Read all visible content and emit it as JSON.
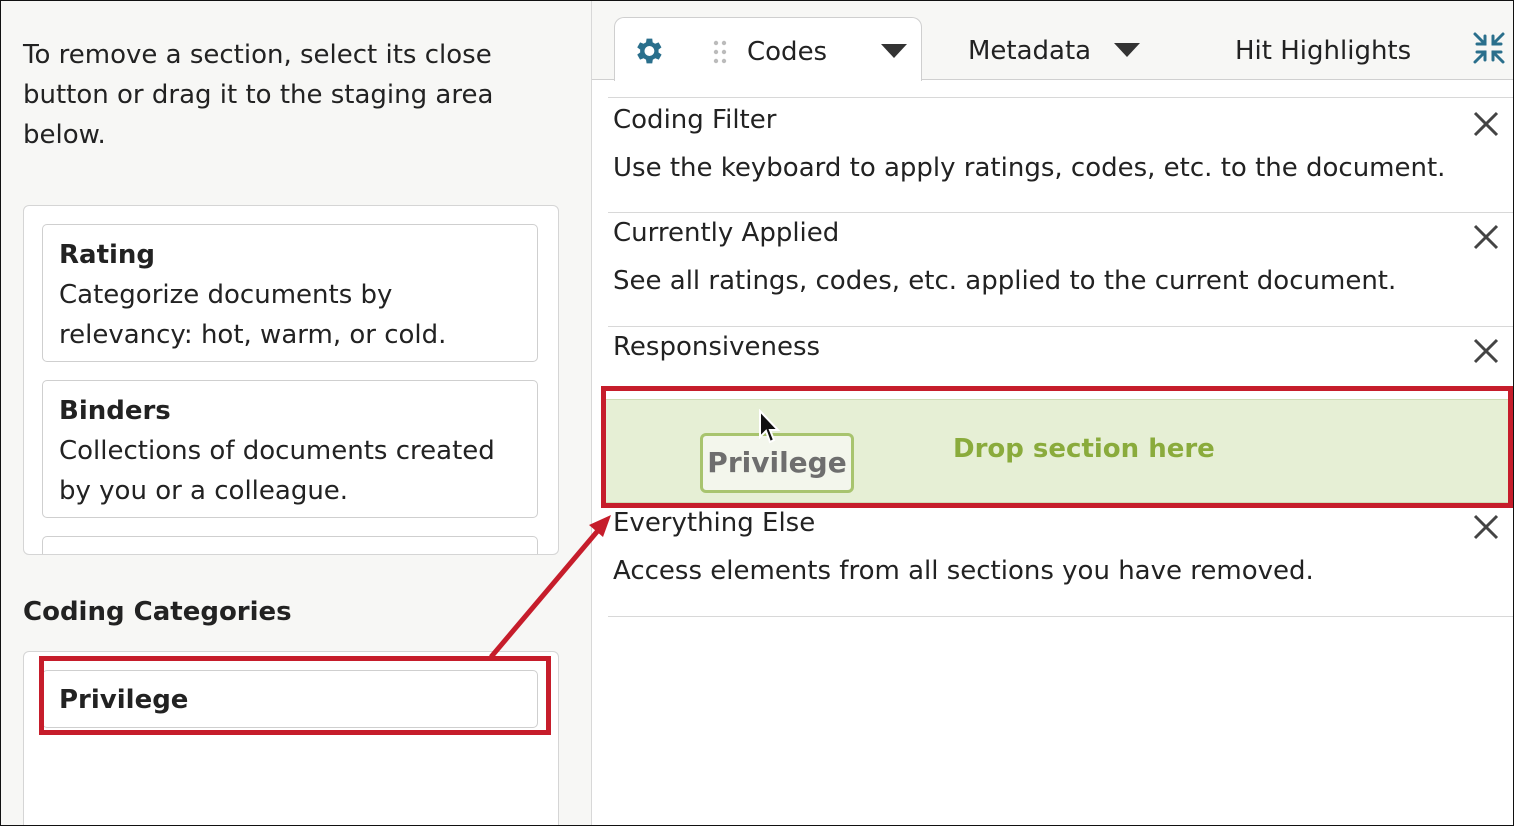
{
  "left": {
    "instructions": "To remove a section, select its close button or drag it to the staging area below.",
    "staging_cards": [
      {
        "title": "Rating",
        "description": "Categorize documents by relevancy: hot, warm, or cold."
      },
      {
        "title": "Binders",
        "description": "Collections of documents created by you or a colleague."
      }
    ],
    "coding_categories_heading": "Coding Categories",
    "coding_categories_item": "Privilege"
  },
  "right": {
    "tabs": [
      {
        "label": "Codes",
        "active": true
      },
      {
        "label": "Metadata",
        "active": false
      },
      {
        "label": "Hit Highlights",
        "active": false
      }
    ],
    "sections": [
      {
        "title": "Coding Filter",
        "description": "Use the keyboard to apply ratings, codes, etc. to the document."
      },
      {
        "title": "Currently Applied",
        "description": "See all ratings, codes, etc. applied to the current document."
      },
      {
        "title": "Responsiveness",
        "description": ""
      },
      {
        "title": "Everything Else",
        "description": "Access elements from all sections you have removed."
      }
    ],
    "drop_zone_text": "Drop section here",
    "dragging_label": "Privilege"
  },
  "colors": {
    "accent": "#2a6f8c",
    "highlight_red": "#c61d2b",
    "drop_green": "#e6efd5",
    "drop_text": "#8aab3c"
  },
  "icons": [
    "gear-icon",
    "drag-handle-icon",
    "caret-down-icon",
    "collapse-icon",
    "close-icon",
    "cursor-icon",
    "arrow-annotation"
  ]
}
